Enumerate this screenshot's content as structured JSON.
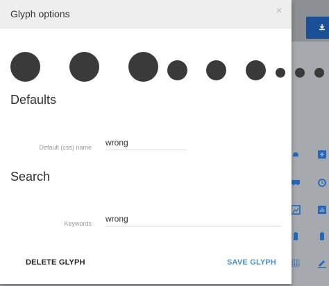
{
  "dialog": {
    "title": "Glyph options",
    "close_glyph": "×"
  },
  "glyph_sizes": [
    "large",
    "large",
    "large",
    "medium",
    "medium",
    "medium",
    "small",
    "small",
    "small"
  ],
  "sections": {
    "defaults_title": "Defaults",
    "search_title": "Search"
  },
  "fields": {
    "css_name_label": "Default (css) name",
    "css_name_value": "wrong",
    "keywords_label": "Keywords",
    "keywords_value": "wrong"
  },
  "buttons": {
    "delete": "DELETE GLYPH",
    "save": "SAVE GLYPH"
  },
  "colors": {
    "accent": "#4a90d9",
    "primary_dark": "#1a4f96",
    "glyph": "#3a3a3a"
  },
  "background_icons": [
    "download-icon",
    "bell-icon",
    "add-box-icon",
    "car-icon",
    "alarm-icon",
    "image-icon",
    "bar-chart-icon",
    "battery-icon",
    "battery-icon",
    "grid-icon",
    "pencil-icon"
  ]
}
